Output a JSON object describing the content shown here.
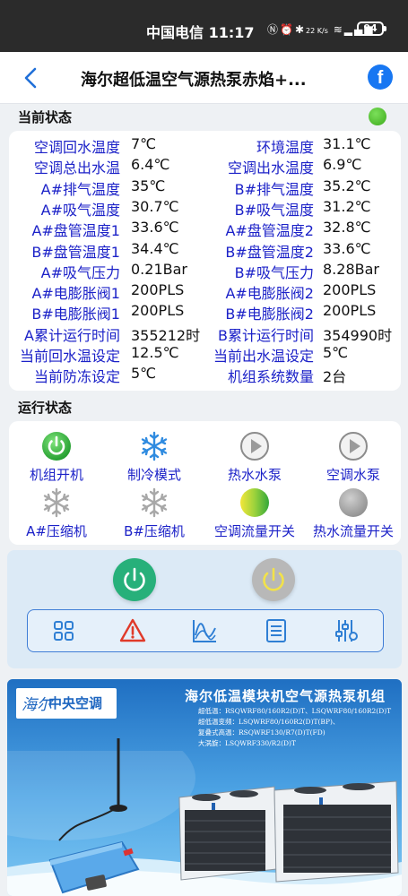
{
  "status_bar": {
    "carrier_time": "中国电信 11:17",
    "network_speed": "22 K/s",
    "battery": "94"
  },
  "header": {
    "title": "海尔超低温空气源热泵赤焰+...",
    "back_icon": "chevron-left-icon",
    "share_icon": "facebook-icon"
  },
  "current_status": {
    "section_title": "当前状态",
    "indicator_color": "#44b424",
    "rows": [
      {
        "l_label": "空调回水温度",
        "l_value": "7℃",
        "r_label": "环境温度",
        "r_value": "31.1℃"
      },
      {
        "l_label": "空调总出水温",
        "l_value": "6.4℃",
        "r_label": "空调出水温度",
        "r_value": "6.9℃"
      },
      {
        "l_label": "A#排气温度",
        "l_value": "35℃",
        "r_label": "B#排气温度",
        "r_value": "35.2℃"
      },
      {
        "l_label": "A#吸气温度",
        "l_value": "30.7℃",
        "r_label": "B#吸气温度",
        "r_value": "31.2℃"
      },
      {
        "l_label": "A#盘管温度1",
        "l_value": "33.6℃",
        "r_label": "A#盘管温度2",
        "r_value": "32.8℃"
      },
      {
        "l_label": "B#盘管温度1",
        "l_value": "34.4℃",
        "r_label": "B#盘管温度2",
        "r_value": "33.6℃"
      },
      {
        "l_label": "A#吸气压力",
        "l_value": "0.21Bar",
        "r_label": "B#吸气压力",
        "r_value": "8.28Bar"
      },
      {
        "l_label": "A#电膨胀阀1",
        "l_value": "200PLS",
        "r_label": "A#电膨胀阀2",
        "r_value": "200PLS"
      },
      {
        "l_label": "B#电膨胀阀1",
        "l_value": "200PLS",
        "r_label": "B#电膨胀阀2",
        "r_value": "200PLS"
      },
      {
        "l_label": "A累计运行时间",
        "l_value": "355212时",
        "r_label": "B累计运行时间",
        "r_value": "354990时"
      },
      {
        "l_label": "当前回水温设定",
        "l_value": "12.5℃",
        "r_label": "当前出水温设定",
        "r_value": "5℃"
      },
      {
        "l_label": "当前防冻设定",
        "l_value": "5℃",
        "r_label": "机组系统数量",
        "r_value": "2台"
      }
    ]
  },
  "operating_status": {
    "section_title": "运行状态",
    "items": [
      {
        "label": "机组开机",
        "icon": "power-on-icon"
      },
      {
        "label": "制冷模式",
        "icon": "snowflake-icon"
      },
      {
        "label": "热水水泵",
        "icon": "pump-play-icon"
      },
      {
        "label": "空调水泵",
        "icon": "pump-play-icon"
      },
      {
        "label": "A#压缩机",
        "icon": "snowflake-icon"
      },
      {
        "label": "B#压缩机",
        "icon": "snowflake-icon"
      },
      {
        "label": "空调流量开关",
        "icon": "flow-switch-on-icon"
      },
      {
        "label": "热水流量开关",
        "icon": "flow-switch-off-icon"
      }
    ]
  },
  "controls": {
    "power_on_icon": "power-on-icon",
    "power_off_icon": "power-off-icon",
    "toolbar": [
      "grid-icon",
      "alarm-warning-icon",
      "chart-icon",
      "list-icon",
      "settings-sliders-icon"
    ]
  },
  "banner": {
    "logo_signature": "海尔",
    "logo_text": "中央空调",
    "title": "海尔低温模块机空气源热泵机组",
    "lines": [
      "超低温：RSQWRF80/160R2(D)T、LSQWRF80/160R2(D)T",
      "超低温变频：LSQWRF80/160R2(D)T(BP)、",
      "复叠式高温：RSQWRF130/R7(D)T(FD)",
      "大涡旋：LSQWRF330/R2(D)T"
    ]
  }
}
